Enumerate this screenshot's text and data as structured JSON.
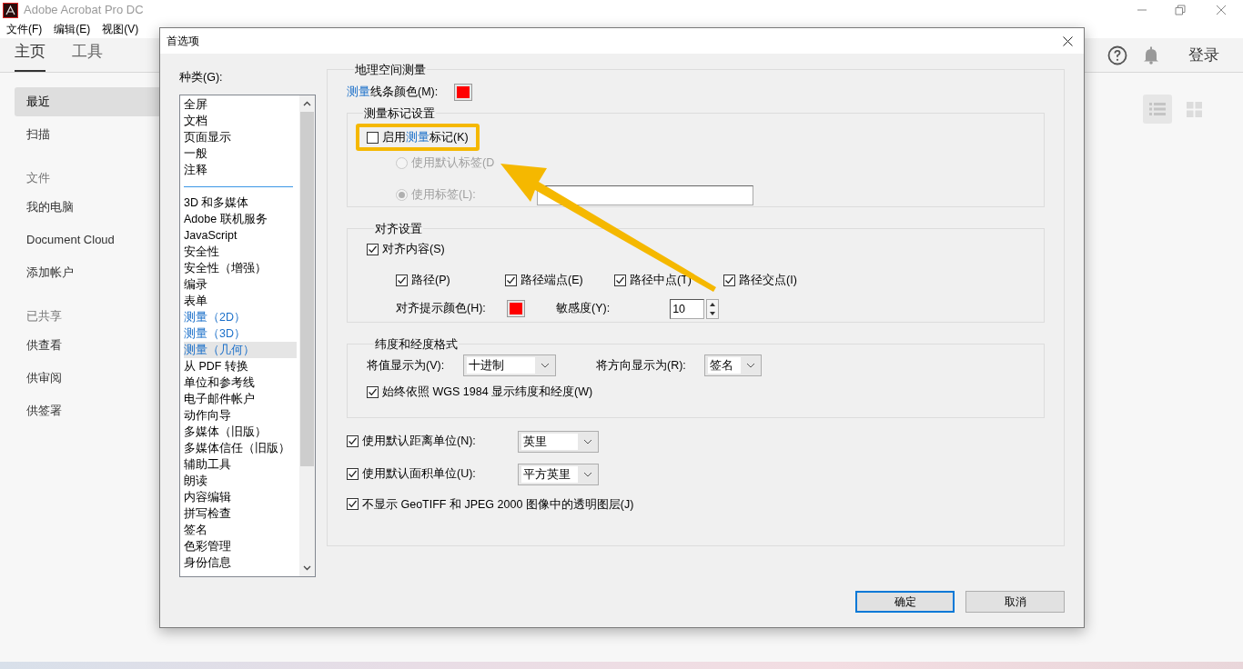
{
  "app": {
    "title": "Adobe Acrobat Pro DC",
    "menu": [
      "文件(F)",
      "编辑(E)",
      "视图(V)"
    ],
    "tabs": [
      {
        "label": "主页",
        "selected": true
      },
      {
        "label": "工具",
        "selected": false
      }
    ],
    "sign_in": "登录",
    "sidebar": [
      {
        "kind": "item",
        "label": "最近",
        "selected": true
      },
      {
        "kind": "item",
        "label": "扫描",
        "selected": false
      },
      {
        "kind": "heading",
        "label": "文件"
      },
      {
        "kind": "item",
        "label": "我的电脑",
        "selected": false
      },
      {
        "kind": "item",
        "label": "Document Cloud",
        "selected": false
      },
      {
        "kind": "item",
        "label": "添加帐户",
        "selected": false
      },
      {
        "kind": "heading",
        "label": "已共享"
      },
      {
        "kind": "item",
        "label": "供查看",
        "selected": false
      },
      {
        "kind": "item",
        "label": "供审阅",
        "selected": false
      },
      {
        "kind": "item",
        "label": "供签署",
        "selected": false
      }
    ],
    "views": [
      {
        "kind": "list",
        "selected": true
      },
      {
        "kind": "grid",
        "selected": false
      }
    ]
  },
  "dialog": {
    "title": "首选项",
    "categories_label": "种类(G):",
    "categories": [
      {
        "kind": "item",
        "label": "全屏",
        "selected": false,
        "emphasized": false
      },
      {
        "kind": "item",
        "label": "文档",
        "selected": false,
        "emphasized": false
      },
      {
        "kind": "item",
        "label": "页面显示",
        "selected": false,
        "emphasized": false
      },
      {
        "kind": "item",
        "label": "一般",
        "selected": false,
        "emphasized": false
      },
      {
        "kind": "item",
        "label": "注释",
        "selected": false,
        "emphasized": false
      },
      {
        "kind": "separator"
      },
      {
        "kind": "item",
        "label": "3D 和多媒体",
        "selected": false,
        "emphasized": false
      },
      {
        "kind": "item",
        "label": "Adobe 联机服务",
        "selected": false,
        "emphasized": false
      },
      {
        "kind": "item",
        "label": "JavaScript",
        "selected": false,
        "emphasized": false
      },
      {
        "kind": "item",
        "label": "安全性",
        "selected": false,
        "emphasized": false
      },
      {
        "kind": "item",
        "label": "安全性（增强）",
        "selected": false,
        "emphasized": false
      },
      {
        "kind": "item",
        "label": "编录",
        "selected": false,
        "emphasized": false
      },
      {
        "kind": "item",
        "label": "表单",
        "selected": false,
        "emphasized": false
      },
      {
        "kind": "item",
        "label": "测量（2D）",
        "selected": false,
        "emphasized": true
      },
      {
        "kind": "item",
        "label": "测量（3D）",
        "selected": false,
        "emphasized": true
      },
      {
        "kind": "item",
        "label": "测量（几何）",
        "selected": true,
        "emphasized": true
      },
      {
        "kind": "item",
        "label": "从 PDF 转换",
        "selected": false,
        "emphasized": false
      },
      {
        "kind": "item",
        "label": "单位和参考线",
        "selected": false,
        "emphasized": false
      },
      {
        "kind": "item",
        "label": "电子邮件帐户",
        "selected": false,
        "emphasized": false
      },
      {
        "kind": "item",
        "label": "动作向导",
        "selected": false,
        "emphasized": false
      },
      {
        "kind": "item",
        "label": "多媒体（旧版）",
        "selected": false,
        "emphasized": false
      },
      {
        "kind": "item",
        "label": "多媒体信任（旧版）",
        "selected": false,
        "emphasized": false
      },
      {
        "kind": "item",
        "label": "辅助工具",
        "selected": false,
        "emphasized": false
      },
      {
        "kind": "item",
        "label": "朗读",
        "selected": false,
        "emphasized": false
      },
      {
        "kind": "item",
        "label": "内容编辑",
        "selected": false,
        "emphasized": false
      },
      {
        "kind": "item",
        "label": "拼写检查",
        "selected": false,
        "emphasized": false
      },
      {
        "kind": "item",
        "label": "签名",
        "selected": false,
        "emphasized": false
      },
      {
        "kind": "item",
        "label": "色彩管理",
        "selected": false,
        "emphasized": false
      },
      {
        "kind": "item",
        "label": "身份信息",
        "selected": false,
        "emphasized": false
      }
    ],
    "geo": {
      "title": "地理空间测量",
      "line_color": {
        "label": [
          {
            "text": "测量",
            "emphasized": true
          },
          {
            "text": "线条颜色(M):",
            "emphasized": false
          }
        ],
        "color": "#ff0000"
      },
      "markers": {
        "title": "测量标记设置",
        "enable": {
          "label": [
            {
              "text": "启用",
              "emphasized": false
            },
            {
              "text": "测量",
              "emphasized": true
            },
            {
              "text": "标记(K)",
              "emphasized": false
            }
          ],
          "checked": false
        },
        "radios": [
          {
            "label": "使用默认标签(D",
            "selected": false,
            "disabled": true
          },
          {
            "label": "使用标签(L):",
            "selected": true,
            "disabled": true
          }
        ]
      },
      "snap": {
        "title": "对齐设置",
        "content": {
          "label": "对齐内容(S)",
          "checked": true
        },
        "options": [
          {
            "label": "路径(P)",
            "checked": true
          },
          {
            "label": "路径端点(E)",
            "checked": true
          },
          {
            "label": "路径中点(T)",
            "checked": true
          },
          {
            "label": "路径交点(I)",
            "checked": true
          }
        ],
        "hint_color": {
          "label": "对齐提示颜色(H):",
          "color": "#ff0000"
        },
        "sensitivity": {
          "label": "敏感度(Y):",
          "value": "10"
        }
      },
      "latlon": {
        "title": "纬度和经度格式",
        "value_format": {
          "label": "将值显示为(V):",
          "value": "十进制"
        },
        "direction": {
          "label": "将方向显示为(R):",
          "value": "签名"
        },
        "wgs": {
          "label": "始终依照 WGS 1984 显示纬度和经度(W)",
          "checked": true
        }
      },
      "units": [
        {
          "label": "使用默认距离单位(N):",
          "checked": true,
          "value": "英里"
        },
        {
          "label": "使用默认面积单位(U):",
          "checked": true,
          "value": "平方英里"
        }
      ],
      "geotiff": {
        "label": "不显示 GeoTIFF 和 JPEG 2000 图像中的透明图层(J)",
        "checked": true
      }
    },
    "buttons": [
      {
        "label": "确定",
        "default": true
      },
      {
        "label": "取消",
        "default": false
      }
    ]
  }
}
